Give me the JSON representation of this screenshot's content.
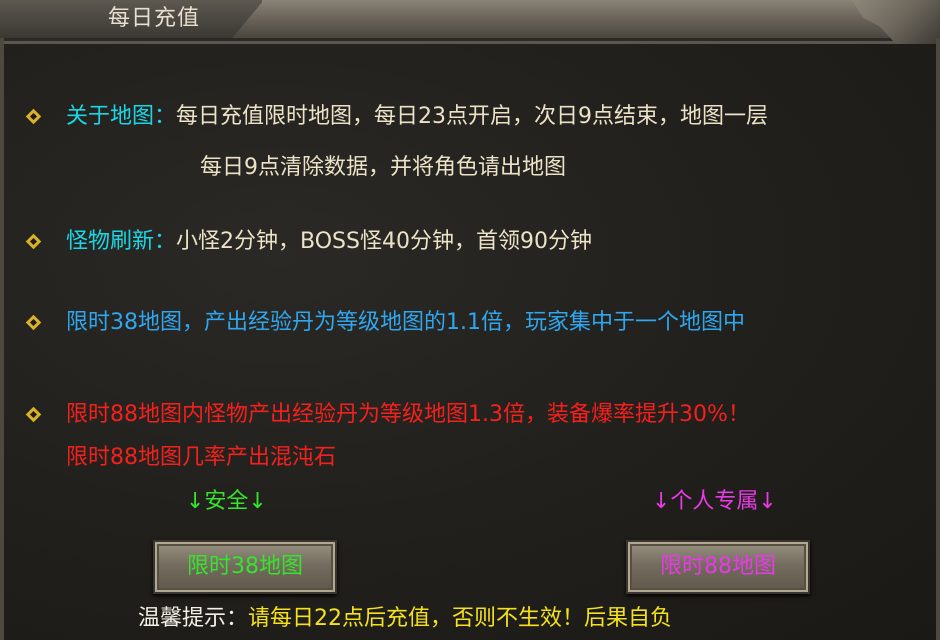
{
  "header": {
    "title": "每日充值"
  },
  "items": [
    {
      "label": "关于地图：",
      "text_line1": "每日充值限时地图，每日23点开启，次日9点结束，地图一层",
      "text_line2": "每日9点清除数据，并将角色请出地图"
    },
    {
      "label": "怪物刷新：",
      "text": "小怪2分钟，BOSS怪40分钟，首领90分钟"
    },
    {
      "text": "限时38地图，产出经验丹为等级地图的1.1倍，玩家集中于一个地图中"
    },
    {
      "text_line1": "限时88地图内怪物产出经验丹为等级地图1.3倍，装备爆率提升30%！",
      "text_line2": "限时88地图几率产出混沌石"
    }
  ],
  "safe_caption": "↓安全↓",
  "personal_caption": "↓个人专属↓",
  "buttons": {
    "map38": "限时38地图",
    "map88": "限时88地图"
  },
  "tip": {
    "label": "温馨提示：",
    "text": "请每日22点后充值，否则不生效！后果自负"
  },
  "colors": {
    "label_cyan": "#1ad7e6",
    "body_beige": "#ece2c8",
    "info_blue": "#2fa7f0",
    "warning_red": "#f5201c",
    "safe_green": "#36e42d",
    "personal_magenta": "#e83ae5",
    "tip_yellow": "#f5e11c",
    "bullet_gold": "#d9b12a"
  },
  "icons": [
    "diamond-bullet-icon"
  ]
}
